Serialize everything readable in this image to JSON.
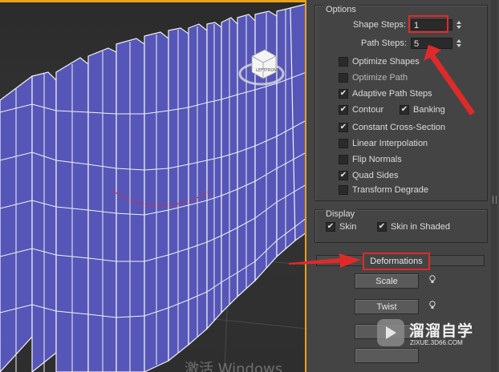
{
  "viewport": {
    "viewcube_faces": {
      "front": "FRONT",
      "top_label": "LEFT"
    },
    "watermark": "激活 Windows"
  },
  "options": {
    "title": "Options",
    "shape_steps": {
      "label": "Shape Steps:",
      "value": "1"
    },
    "path_steps": {
      "label": "Path Steps:",
      "value": "5"
    },
    "checkboxes": [
      {
        "label": "Optimize Shapes",
        "checked": false
      },
      {
        "label": "Optimize Path",
        "checked": false
      },
      {
        "label": "Adaptive Path Steps",
        "checked": true
      },
      {
        "label": "Contour",
        "checked": true
      },
      {
        "label": "Banking",
        "checked": true
      },
      {
        "label": "Constant Cross-Section",
        "checked": true
      },
      {
        "label": "Linear Interpolation",
        "checked": false
      },
      {
        "label": "Flip Normals",
        "checked": false
      },
      {
        "label": "Quad Sides",
        "checked": true
      },
      {
        "label": "Transform Degrade",
        "checked": false
      }
    ]
  },
  "display": {
    "title": "Display",
    "skin": {
      "label": "Skin",
      "checked": true
    },
    "skin_shaded": {
      "label": "Skin in Shaded",
      "checked": true
    }
  },
  "deformations": {
    "title": "Deformations",
    "scale_label": "Scale",
    "twist_label": "Twist"
  },
  "logo": {
    "name": "溜溜自学",
    "url": "ZIXUE.3D66.COM"
  },
  "colors": {
    "highlight": "#e02a2a",
    "viewport_border": "#e8a21a",
    "object_fill": "#5656b8",
    "wire": "#f2f2f2"
  }
}
